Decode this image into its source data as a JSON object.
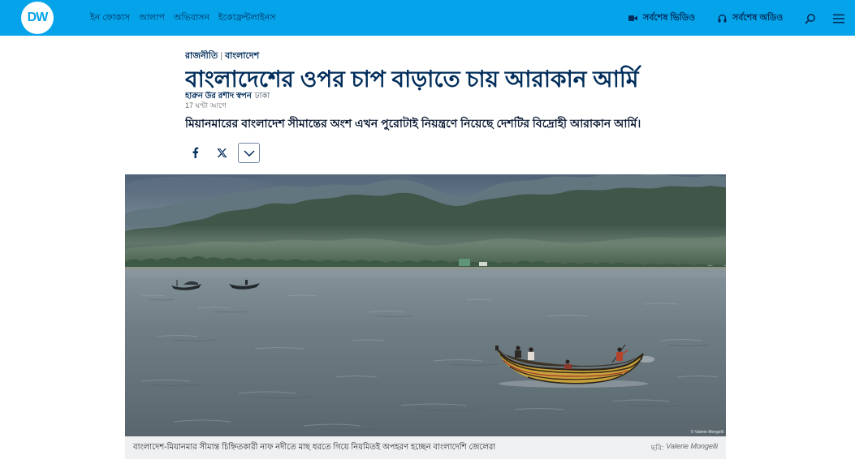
{
  "header": {
    "logo_text": "DW",
    "nav": [
      {
        "label": "ইন ফোকাস"
      },
      {
        "label": "আলাপ"
      },
      {
        "label": "অভিবাসন"
      },
      {
        "label": "ইকোফ্রন্টলাইনস"
      }
    ],
    "latest_video": {
      "label": "সর্বশেষ ভিডিও",
      "icon": "video-camera-icon"
    },
    "latest_audio": {
      "label": "সর্বশেষ অডিও",
      "icon": "headphones-icon"
    },
    "search_icon": "search-icon",
    "menu_icon": "hamburger-menu-icon"
  },
  "article": {
    "breadcrumb": {
      "section": "রাজনীতি",
      "separator": "|",
      "subsection": "বাংলাদেশ"
    },
    "title": "বাংলাদেশের ওপর চাপ বাড়াতে চায় আরাকান আর্মি",
    "author": "হারুন উর রশীদ স্বপন",
    "location": "ঢাকা",
    "published": "17 ঘণ্টা আগে",
    "lead": "মিয়ানমারের বাংলাদেশ সীমান্তের অংশ এখন পুরোটাই নিয়ন্ত্রণে নিয়েছে দেশটির বিদ্রোহী আরাকান আর্মি।",
    "share_icons": [
      "facebook-icon",
      "x-icon",
      "chevron-down-icon"
    ]
  },
  "hero_image": {
    "watermark": "© Valerie Mongelli",
    "caption": "বাংলাদেশ-মিয়ানমার সীমান্ত চিহ্নিতকারী নাফ নদীতে মাছ ধরতে গিয়ে নিয়মিতই অপহরণ হচ্ছেন বাংলাদেশি জেলেরা",
    "credit_label": "ছবি:",
    "credit_name": "Valerie Mongelli"
  },
  "colors": {
    "header_bg": "#05a4ea",
    "navy": "#002d5a",
    "text_dark": "#0b1a33",
    "muted": "#6b6b6b",
    "caption_bg": "#eef0f2"
  }
}
